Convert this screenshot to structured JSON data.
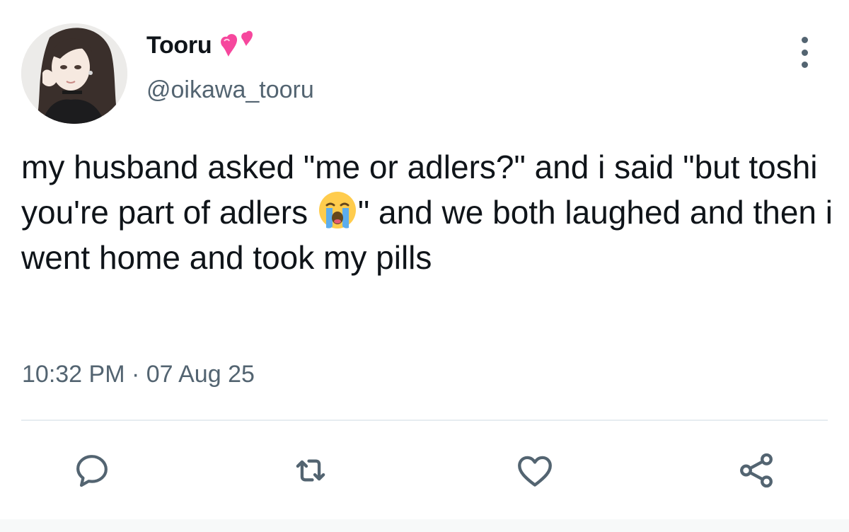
{
  "author": {
    "display_name": "Tooru",
    "handle": "@oikawa_tooru",
    "name_emoji": "two-hearts-icon",
    "avatar": "avatar-image"
  },
  "tweet": {
    "text_part1": "my husband asked \"me or adlers?\" and i said \"but toshi you're part of adlers ",
    "inline_emoji": "loudly-crying-face-icon",
    "text_part2": "\" and we both laughed and then i went home and took my pills",
    "timestamp": "10:32 PM · 07 Aug 25"
  },
  "actions": [
    {
      "name": "reply",
      "icon": "reply-icon"
    },
    {
      "name": "retweet",
      "icon": "retweet-icon"
    },
    {
      "name": "like",
      "icon": "heart-icon"
    },
    {
      "name": "share",
      "icon": "share-icon"
    }
  ],
  "colors": {
    "text_primary": "#0f1419",
    "text_secondary": "#536471",
    "heart_pink": "#f6479d",
    "divider": "#e6ecf0"
  }
}
